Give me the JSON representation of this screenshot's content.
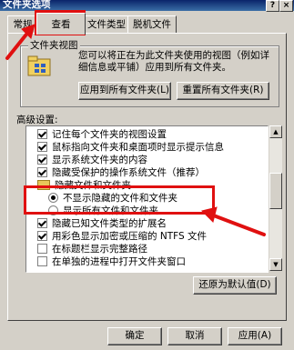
{
  "window": {
    "title": "文件夹选项",
    "help_glyph": "?",
    "close_glyph": "×"
  },
  "tabs": [
    {
      "label": "常规"
    },
    {
      "label": "查看"
    },
    {
      "label": "文件类型"
    },
    {
      "label": "脱机文件"
    }
  ],
  "folder_views": {
    "title": "文件夹视图",
    "description": "您可以将正在为此文件夹使用的视图（例如详细信息或平铺）应用到所有文件夹。",
    "apply_all_label": "应用到所有文件夹(L)",
    "reset_all_label": "重置所有文件夹(R)"
  },
  "advanced": {
    "label": "高级设置:",
    "items": [
      {
        "type": "checkbox",
        "checked": true,
        "label": "记住每个文件夹的视图设置"
      },
      {
        "type": "checkbox",
        "checked": true,
        "label": "鼠标指向文件夹和桌面项时显示提示信息"
      },
      {
        "type": "checkbox",
        "checked": true,
        "label": "显示系统文件夹的内容"
      },
      {
        "type": "checkbox",
        "checked": true,
        "label": "隐藏受保护的操作系统文件（推荐）"
      },
      {
        "type": "folder",
        "label": "隐藏文件和文件夹"
      },
      {
        "type": "radio",
        "checked": true,
        "label": "不显示隐藏的文件和文件夹"
      },
      {
        "type": "radio",
        "checked": false,
        "label": "显示所有文件和文件夹"
      },
      {
        "type": "checkbox",
        "checked": true,
        "label": "隐藏已知文件类型的扩展名"
      },
      {
        "type": "checkbox",
        "checked": true,
        "label": "用彩色显示加密或压缩的 NTFS 文件"
      },
      {
        "type": "checkbox",
        "checked": false,
        "label": "在标题栏显示完整路径"
      },
      {
        "type": "checkbox",
        "checked": false,
        "label": "在单独的进程中打开文件夹窗口"
      }
    ],
    "restore_defaults_label": "还原为默认值(D)"
  },
  "footer": {
    "ok_label": "确定",
    "cancel_label": "取消",
    "apply_label": "应用(A)"
  },
  "colors": {
    "annotation_red": "#e01010",
    "titlebar": "#0a246a"
  }
}
